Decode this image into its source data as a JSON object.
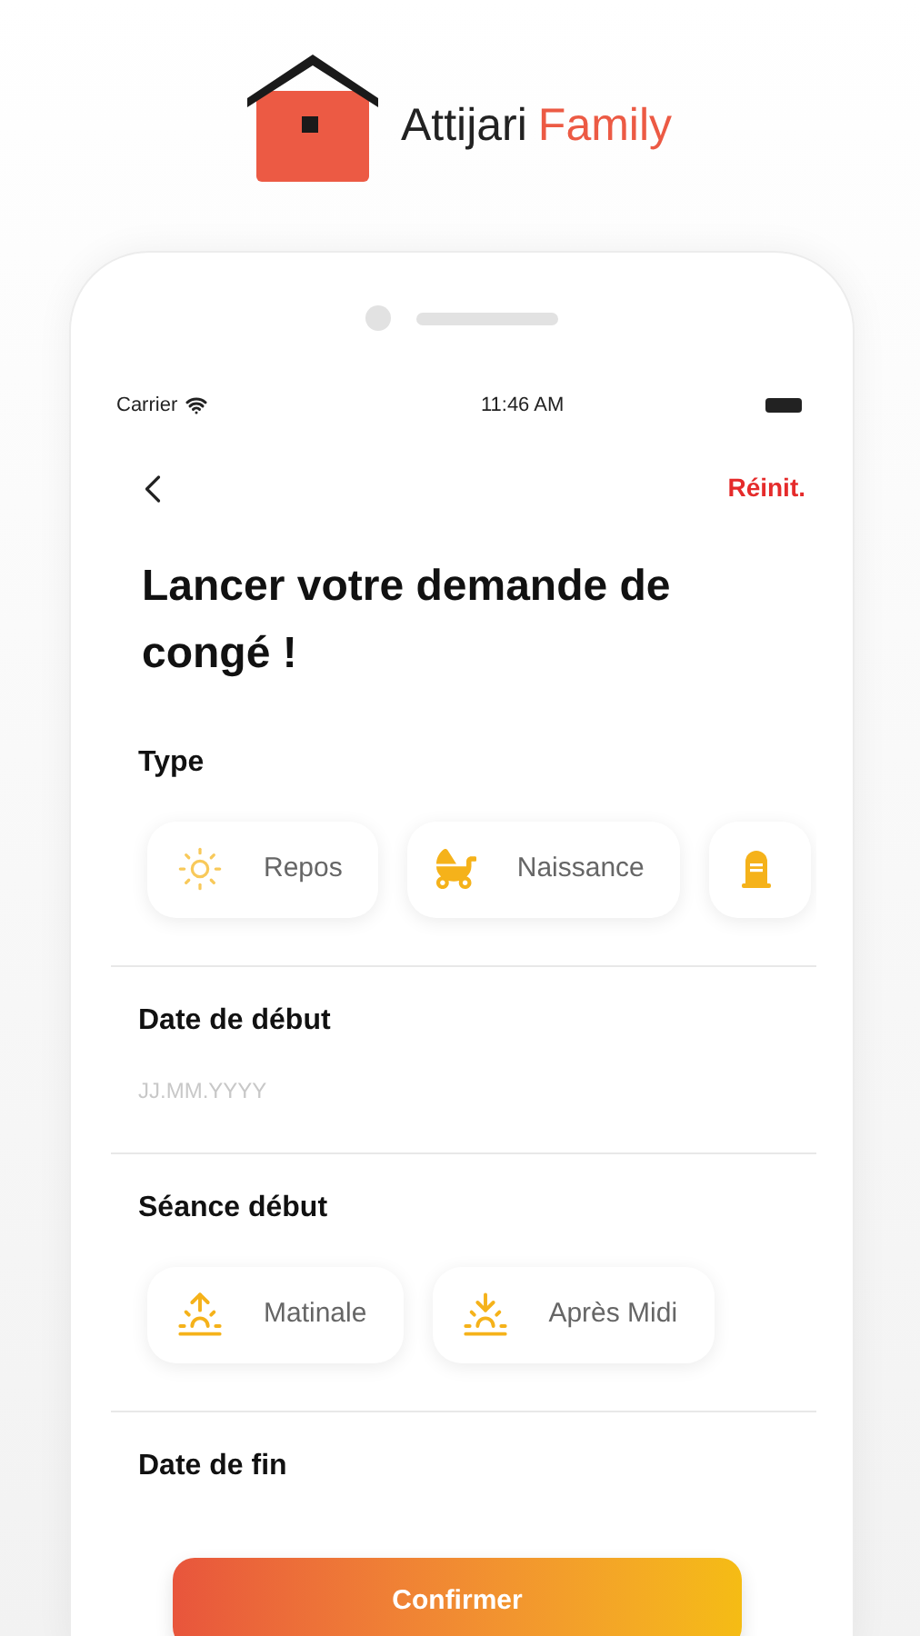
{
  "brand": {
    "name": "Attijari",
    "name_accent": "Family"
  },
  "status_bar": {
    "carrier": "Carrier",
    "time": "11:46 AM"
  },
  "header": {
    "reset_link": "Réinit."
  },
  "title": "Lancer votre demande de congé !",
  "sections": [
    {
      "kind": "chips",
      "label": "Type",
      "chips": [
        {
          "kind": "sun",
          "label": "Repos"
        },
        {
          "kind": "stroller",
          "label": "Naissance"
        },
        {
          "kind": "grave"
        }
      ]
    },
    {
      "kind": "date",
      "label": "Date de début",
      "placeholder": "JJ.MM.YYYY"
    },
    {
      "kind": "chips",
      "label": "Séance début",
      "chips": [
        {
          "kind": "sunrise",
          "label": "Matinale"
        },
        {
          "kind": "sunset",
          "label": "Après Midi"
        }
      ]
    },
    {
      "kind": "date",
      "label": "Date de fin"
    }
  ],
  "confirm_button": "Confirmer"
}
